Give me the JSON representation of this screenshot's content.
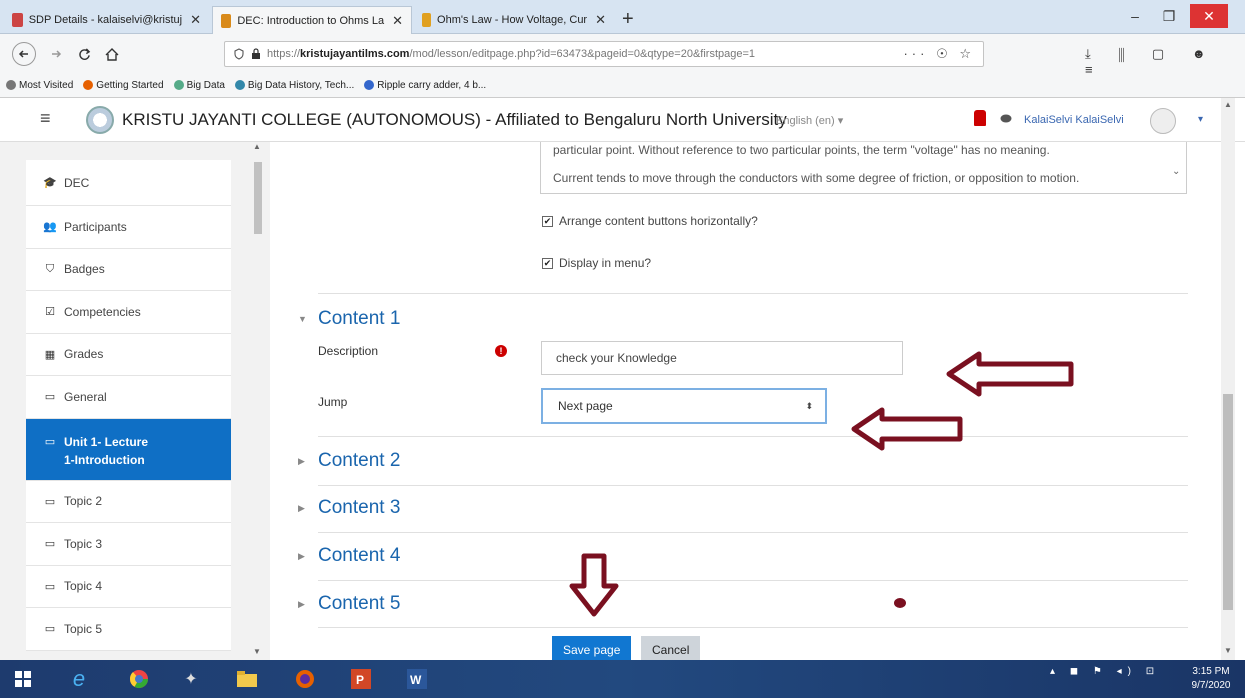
{
  "browser": {
    "tabs": [
      {
        "title": "SDP Details - kalaiselvi@kristuj",
        "active": false,
        "favicon_color": "#c44"
      },
      {
        "title": "DEC: Introduction to Ohms La",
        "active": true,
        "favicon_color": "#d98a1a"
      },
      {
        "title": "Ohm's Law - How Voltage, Cur",
        "active": false,
        "favicon_color": "#e0a020"
      }
    ],
    "close_glyph": "✕",
    "new_tab": "+",
    "window_controls": [
      "–",
      "❐",
      "✕"
    ],
    "url_prefix": "https://",
    "url_host": "kristujayantilms.com",
    "url_path": "/mod/lesson/editpage.php?id=63473&pageid=0&qtype=20&firstpage=1",
    "url_icons": "··· ☉ ☆",
    "toolbar_icons": "⤓ ⫼ ▢ ☻ ≡",
    "bookmarks": [
      {
        "label": "Most Visited",
        "icon_color": "#777"
      },
      {
        "label": "Getting Started",
        "icon_color": "#e66000"
      },
      {
        "label": "Big Data",
        "icon_color": "#5a8"
      },
      {
        "label": "Big Data History, Tech...",
        "icon_color": "#38a"
      },
      {
        "label": "Ripple carry adder, 4 b...",
        "icon_color": "#36c"
      }
    ]
  },
  "header": {
    "menu_icon": "≡",
    "site_name": "KRISTU JAYANTI COLLEGE (AUTONOMOUS) - Affiliated to Bengaluru North University",
    "language": "English (en) ▾",
    "user_name": "KalaiSelvi KalaiSelvi",
    "user_menu": "▾"
  },
  "sidebar": {
    "items": [
      {
        "icon": "🎓",
        "label": "DEC"
      },
      {
        "icon": "👥",
        "label": "Participants"
      },
      {
        "icon": "⛉",
        "label": "Badges"
      },
      {
        "icon": "☑",
        "label": "Competencies"
      },
      {
        "icon": "▦",
        "label": "Grades"
      },
      {
        "icon": "▭",
        "label": "General"
      },
      {
        "icon": "▭",
        "label_line1": "Unit 1- Lecture",
        "label_line2": "1-Introduction",
        "active": true
      },
      {
        "icon": "▭",
        "label": "Topic 2"
      },
      {
        "icon": "▭",
        "label": "Topic 3"
      },
      {
        "icon": "▭",
        "label": "Topic 4"
      },
      {
        "icon": "▭",
        "label": "Topic 5"
      }
    ]
  },
  "editor": {
    "line1": "particular point. Without reference to two particular points, the term \"voltage\" has no meaning.",
    "line2": "Current tends to move through the conductors with some degree of friction, or opposition to motion."
  },
  "options": {
    "arrange_horizontally": "Arrange content buttons horizontally?",
    "display_in_menu": "Display in menu?",
    "check": "✔"
  },
  "content1": {
    "heading": "Content 1",
    "description_label": "Description",
    "required_mark": "!",
    "description_value": "check your Knowledge",
    "jump_label": "Jump",
    "jump_value": "Next page",
    "jump_arrow": "⬍"
  },
  "sections": [
    "Content 2",
    "Content 3",
    "Content 4",
    "Content 5"
  ],
  "buttons": {
    "save": "Save page",
    "cancel": "Cancel"
  },
  "annotation_color": "#7a1020",
  "taskbar": {
    "tray": "▴ ◼ ⚑ ◂) ⊡",
    "time": "3:15 PM",
    "date": "9/7/2020"
  }
}
